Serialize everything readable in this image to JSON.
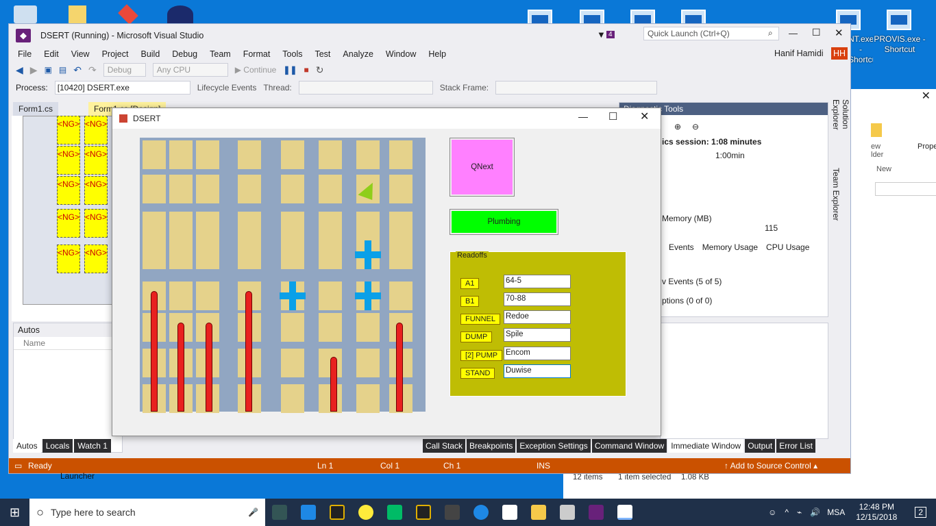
{
  "desktop": {
    "icons": [
      {
        "label": "PROVIS.exe - Shortcut"
      },
      {
        "label": "NT.exe - Shortcut"
      }
    ],
    "launcher_label": "Launcher"
  },
  "vs": {
    "title": "DSERT (Running) - Microsoft Visual Studio",
    "filter_count": "4",
    "quick_launch_placeholder": "Quick Launch (Ctrl+Q)",
    "user": "Hanif Hamidi",
    "initials": "HH",
    "menu": [
      "File",
      "Edit",
      "View",
      "Project",
      "Build",
      "Debug",
      "Team",
      "Format",
      "Tools",
      "Test",
      "Analyze",
      "Window",
      "Help"
    ],
    "toolbar": {
      "config": "Debug",
      "platform": "Any CPU",
      "continue": "Continue"
    },
    "process_label": "Process:",
    "process_value": "[10420] DSERT.exe",
    "lifecycle": "Lifecycle Events",
    "thread_label": "Thread:",
    "stack_label": "Stack Frame:",
    "tabs": [
      "Form1.cs",
      "Form1.cs [Design]"
    ],
    "ng_label": "<NG>",
    "autos": {
      "title": "Autos",
      "col_name": "Name"
    },
    "bottom_tabs_left": [
      "Autos",
      "Locals",
      "Watch 1"
    ],
    "bottom_tabs_right": [
      "Call Stack",
      "Breakpoints",
      "Exception Settings",
      "Command Window",
      "Immediate Window",
      "Output",
      "Error List"
    ],
    "diag": {
      "title": "Diagnostic Tools",
      "session": "ics session: 1:08 minutes",
      "timer": "1:00min",
      "memory": "Memory (MB)",
      "mem_val": "115",
      "tabs": [
        "Events",
        "Memory Usage",
        "CPU Usage"
      ],
      "events": "v Events (5 of 5)",
      "exceptions": "ptions (0 of 0)"
    },
    "side_tabs": [
      "Solution Explorer",
      "Team Explorer"
    ],
    "status": {
      "ready": "Ready",
      "ln": "Ln 1",
      "col": "Col 1",
      "ch": "Ch 1",
      "ins": "INS",
      "source": "Add to Source Control"
    }
  },
  "dsert": {
    "title": "DSERT",
    "qnext": "QNext",
    "plumbing": "Plumbing",
    "readoffs_title": "Readoffs",
    "rows": [
      {
        "label": "A1",
        "value": "64-5"
      },
      {
        "label": "B1",
        "value": "70-88"
      },
      {
        "label": "FUNNEL",
        "value": "Redoe"
      },
      {
        "label": "DUMP",
        "value": "Spile"
      },
      {
        "label": "[2] PUMP",
        "value": "Encom"
      },
      {
        "label": "STAND",
        "value": "Duwise"
      }
    ]
  },
  "explorer": {
    "new_folder": "ew\nlder",
    "new": "New",
    "props": "Prope",
    "items": "12 items",
    "selected": "1 item selected",
    "size": "1.08 KB"
  },
  "taskbar": {
    "search": "Type here to search",
    "lang": "MSA",
    "time": "12:48 PM",
    "date": "12/15/2018",
    "notif": "2"
  }
}
